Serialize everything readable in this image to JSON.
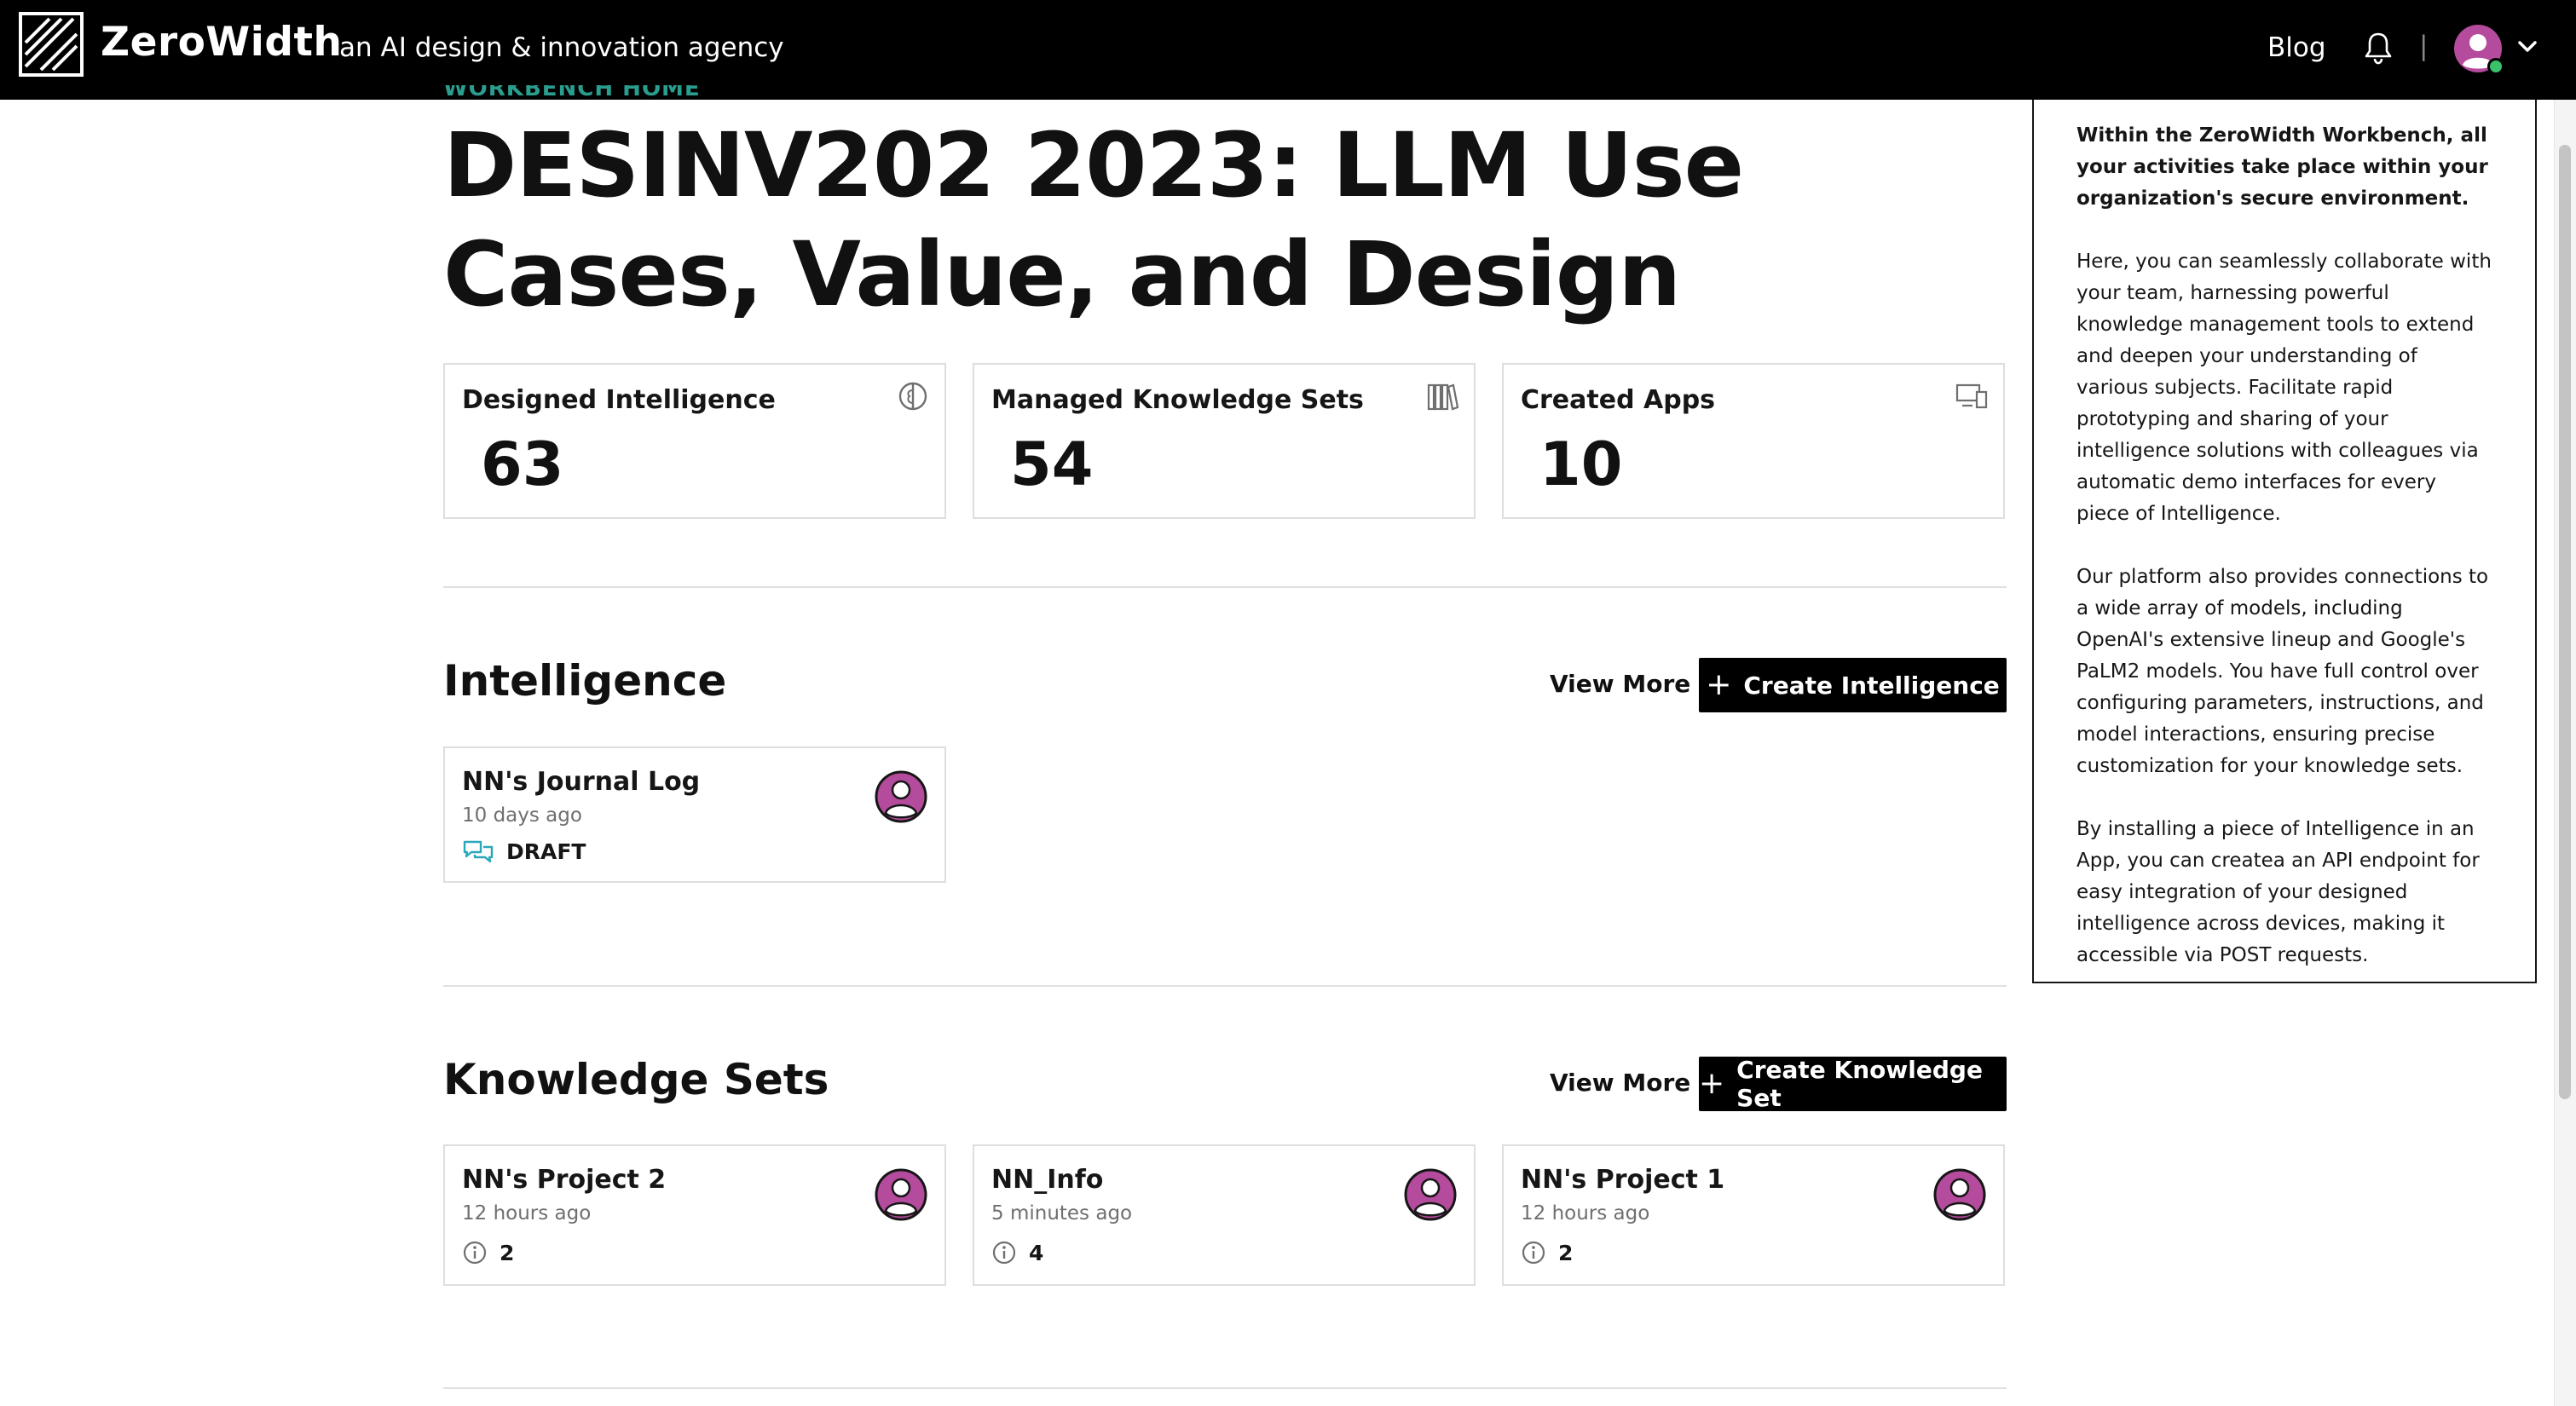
{
  "topbar": {
    "brand": "ZeroWidth",
    "tagline": "an AI design & innovation agency",
    "blog_label": "Blog",
    "separator": "|",
    "icons": [
      "zerowidth-logo-icon",
      "bell-icon",
      "user-avatar-icon",
      "chevron-down-icon"
    ]
  },
  "header": {
    "eyebrow": "WORKBENCH HOME",
    "title": "DESINV202 2023: LLM Use Cases, Value, and Design"
  },
  "stats": [
    {
      "label": "Designed Intelligence",
      "value": "63",
      "icon": "brain-icon"
    },
    {
      "label": "Managed Knowledge Sets",
      "value": "54",
      "icon": "library-books-icon"
    },
    {
      "label": "Created Apps",
      "value": "10",
      "icon": "devices-icon"
    }
  ],
  "intelligence": {
    "title": "Intelligence",
    "view_more": "View More",
    "create_label": "Create Intelligence",
    "items": [
      {
        "title": "NN's Journal Log",
        "time": "10 days ago",
        "status": "DRAFT",
        "icon": "chat-bubbles-icon"
      }
    ]
  },
  "knowledge_sets": {
    "title": "Knowledge Sets",
    "view_more": "View More",
    "create_label": "Create Knowledge Set",
    "items": [
      {
        "title": "NN's Project 2",
        "time": "12 hours ago",
        "count": "2",
        "icon": "info-icon"
      },
      {
        "title": "NN_Info",
        "time": "5 minutes ago",
        "count": "4",
        "icon": "info-icon"
      },
      {
        "title": "NN's Project 1",
        "time": "12 hours ago",
        "count": "2",
        "icon": "info-icon"
      }
    ]
  },
  "info_panel": {
    "paragraphs": [
      "Within the ZeroWidth Workbench, all your activities take place within your organization's secure environment.",
      "Here, you can seamlessly collaborate with your team, harnessing powerful knowledge management tools to extend and deepen your understanding of various subjects. Facilitate rapid prototyping and sharing of your intelligence solutions with colleagues via automatic demo interfaces for every piece of Intelligence.",
      "Our platform also provides connections to a wide array of models, including OpenAI's extensive lineup and Google's PaLM2 models. You have full control over configuring parameters, instructions, and model interactions, ensuring precise customization for your knowledge sets.",
      "By installing a piece of Intelligence in an App, you can createa an API endpoint for easy integration of your designed intelligence across devices, making it accessible via POST requests."
    ]
  },
  "colors": {
    "topbar_bg": "#000000",
    "accent_avatar": "#b54b9c",
    "online_status": "#39c26a",
    "chat_icon": "#2aa7b8",
    "eyebrow": "#2a9d8f"
  }
}
